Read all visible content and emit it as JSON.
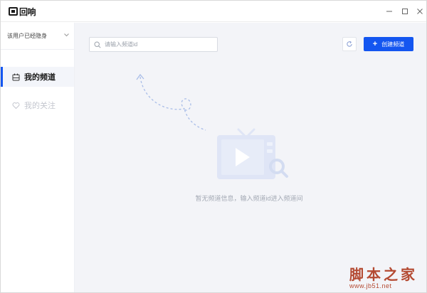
{
  "app": {
    "name": "回响"
  },
  "window_controls": {
    "minimize": "—",
    "maximize": "□",
    "close": "✕"
  },
  "sidebar": {
    "user_label": "该用户已经隐身",
    "items": [
      {
        "label": "我的频道",
        "icon": "calendar-icon",
        "active": true
      },
      {
        "label": "我的关注",
        "icon": "heart-icon",
        "active": false
      }
    ]
  },
  "toolbar": {
    "search_placeholder": "请输入频道id",
    "create_label": "创建频道"
  },
  "empty_state": {
    "text": "暂无频道信息，输入频道id进入频道间"
  },
  "watermark": {
    "cn": "脚本之家",
    "url": "www.jb51.net",
    "color": "#b44a32"
  },
  "colors": {
    "accent": "#1456f0",
    "content_bg": "#f3f4f8",
    "illustration": "#dfe5f6"
  }
}
